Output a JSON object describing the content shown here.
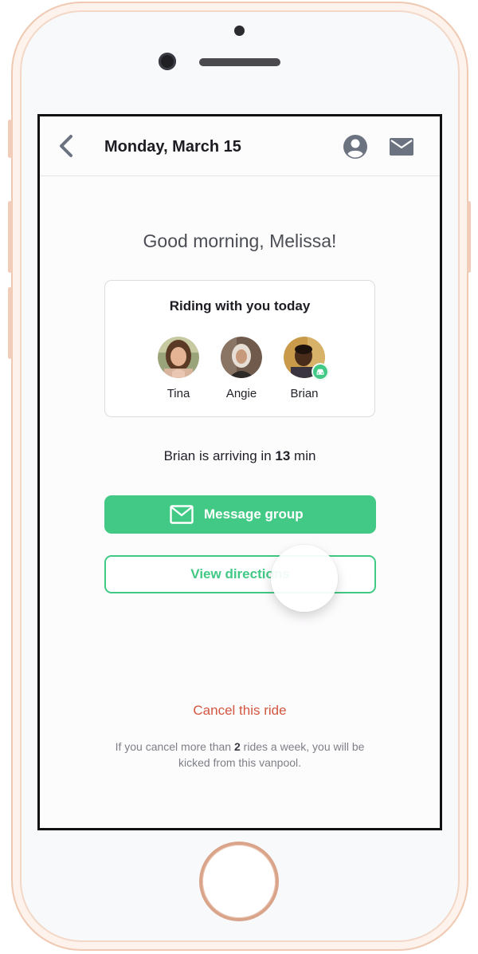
{
  "header": {
    "title": "Monday, March 15",
    "back_icon": "chevron-left-icon",
    "profile_icon": "user-circle-icon",
    "messages_icon": "envelope-icon"
  },
  "greeting": "Good morning, Melissa!",
  "riders_card": {
    "title": "Riding with you today",
    "riders": [
      {
        "name": "Tina"
      },
      {
        "name": "Angie"
      },
      {
        "name": "Brian",
        "badge_icon": "car-icon"
      }
    ]
  },
  "arrival": {
    "prefix": "Brian is arriving in ",
    "minutes": "13",
    "suffix": " min"
  },
  "actions": {
    "message_group": "Message group",
    "view_directions": "View directions"
  },
  "cancel": {
    "link": "Cancel this ride",
    "policy_prefix": "If you cancel more than ",
    "policy_count": "2",
    "policy_suffix": " rides a week, you will be kicked from this vanpool."
  },
  "colors": {
    "accent_green": "#42c985",
    "cancel_red": "#d2563f",
    "icon_gray": "#6b7280"
  }
}
